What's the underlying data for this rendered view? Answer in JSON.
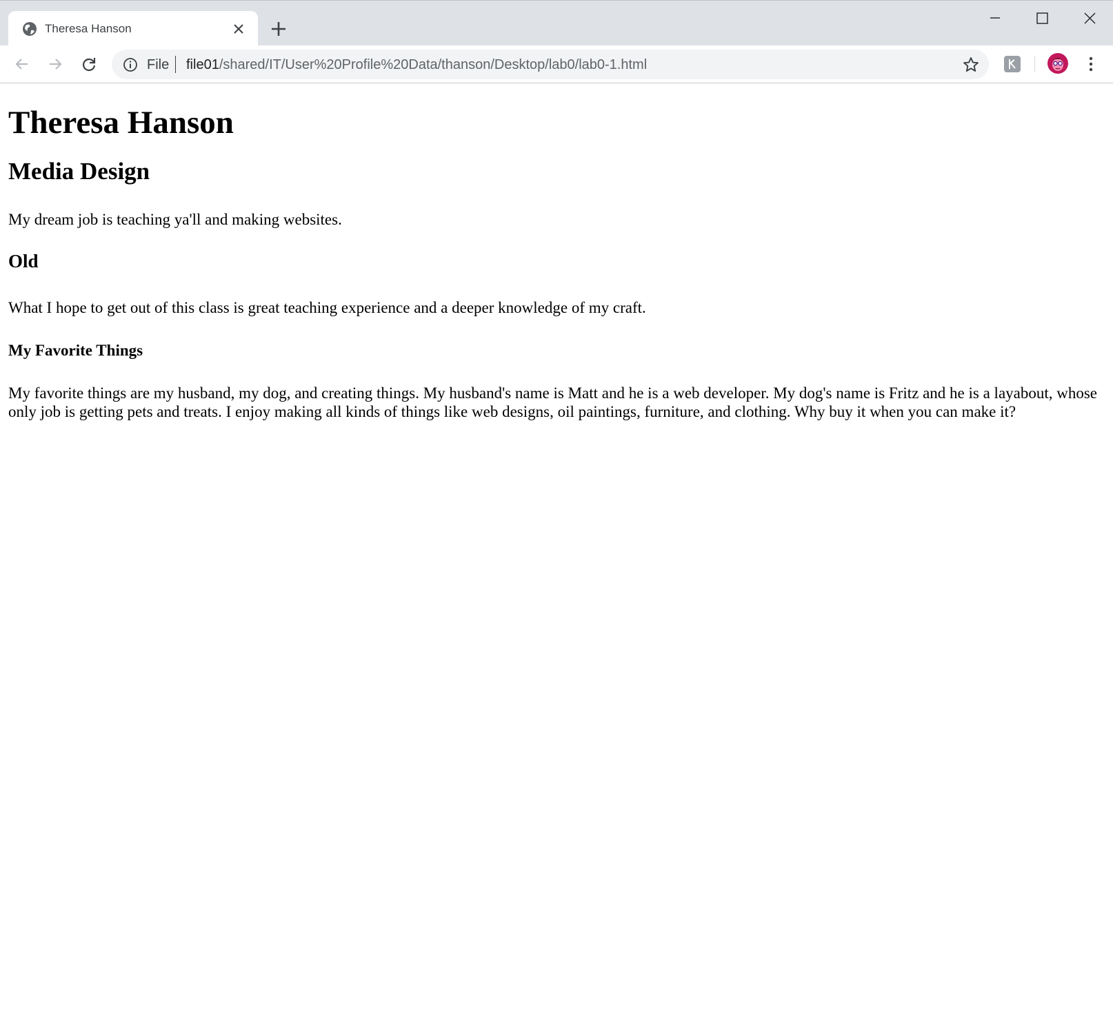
{
  "browser": {
    "tab": {
      "title": "Theresa Hanson",
      "favicon": "globe-icon"
    },
    "new_tab_icon": "plus-icon",
    "window_controls": [
      "minimize-icon",
      "maximize-icon",
      "close-icon"
    ],
    "address_bar": {
      "scheme_label": "File",
      "url_host": "file01",
      "url_path": "/shared/IT/User%20Profile%20Data/thanson/Desktop/lab0/lab0-1.html"
    },
    "colors": {
      "tabstrip": "#dee1e6",
      "omnibox": "#f1f3f4",
      "avatar": "#c2185b"
    }
  },
  "page": {
    "name_heading": "Theresa Hanson",
    "program_heading": "Media Design",
    "dream_paragraph": "My dream job is teaching ya'll and making websites.",
    "age_heading": "Old",
    "hope_paragraph": "What I hope to get out of this class is great teaching experience and a deeper knowledge of my craft.",
    "favorites_heading": "My Favorite Things",
    "favorites_paragraph": "My favorite things are my husband, my dog, and creating things. My husband's name is Matt and he is a web developer. My dog's name is Fritz and he is a layabout, whose only job is getting pets and treats. I enjoy making all kinds of things like web designs, oil paintings, furniture, and clothing. Why buy it when you can make it?"
  }
}
